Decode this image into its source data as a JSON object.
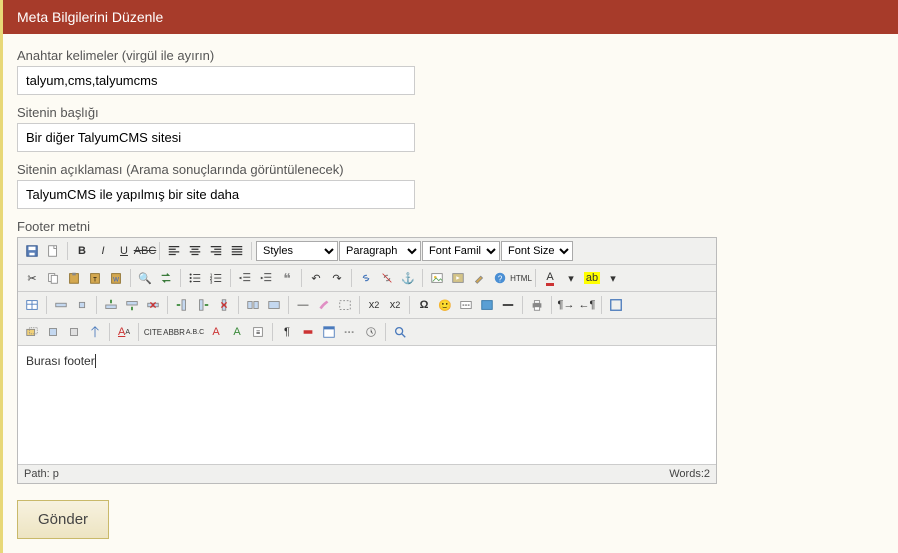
{
  "header": {
    "title": "Meta Bilgilerini Düzenle"
  },
  "fields": {
    "keywords_label": "Anahtar kelimeler (virgül ile ayırın)",
    "keywords_value": "talyum,cms,talyumcms",
    "title_label": "Sitenin başlığı",
    "title_value": "Bir diğer TalyumCMS sitesi",
    "desc_label": "Sitenin açıklaması (Arama sonuçlarında görüntülenecek)",
    "desc_value": "TalyumCMS ile yapılmış bir site daha",
    "footer_label": "Footer metni"
  },
  "editor": {
    "dropdowns": {
      "styles": "Styles",
      "paragraph": "Paragraph",
      "font_family": "Font Family",
      "font_size": "Font Size"
    },
    "body_text": "Burası footer",
    "path_label": "Path: p",
    "words_label": "Words:2"
  },
  "submit": {
    "label": "Gönder"
  }
}
